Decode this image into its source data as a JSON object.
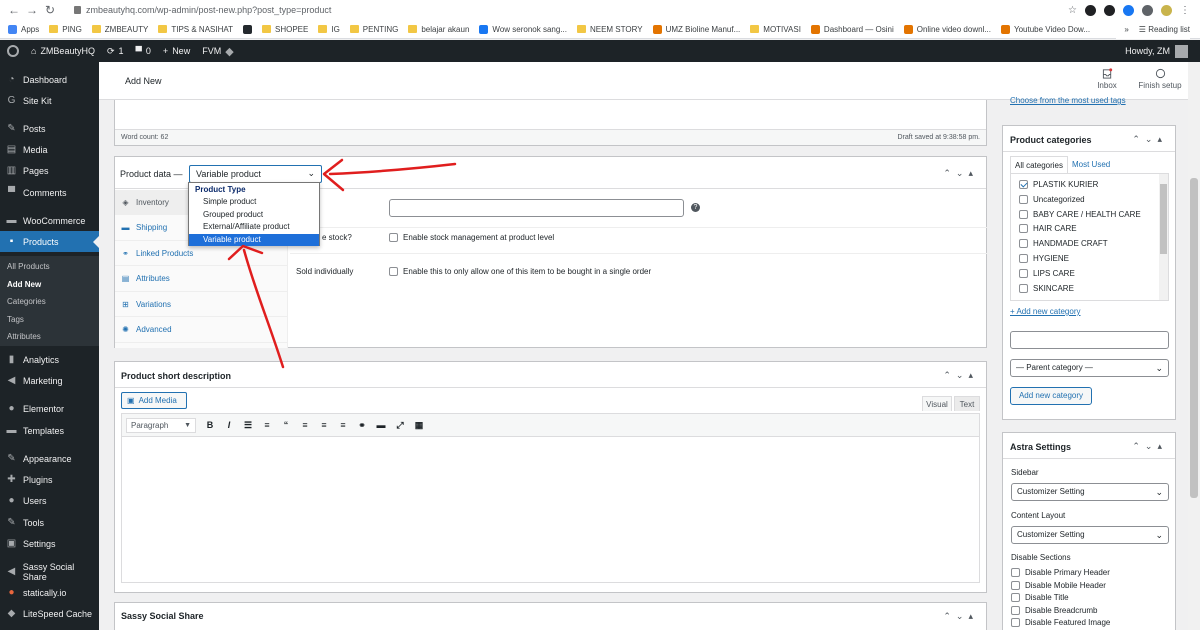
{
  "browser": {
    "url": "zmbeautyhq.com/wp-admin/post-new.php?post_type=product",
    "bookmarks": [
      {
        "label": "Apps",
        "icon": "apps-grid-icon"
      },
      {
        "label": "PING",
        "icon": "folder-icon"
      },
      {
        "label": "ZMBEAUTY",
        "icon": "folder-icon"
      },
      {
        "label": "TIPS & NASIHAT",
        "icon": "folder-icon"
      },
      {
        "label": "",
        "icon": "github-icon"
      },
      {
        "label": "SHOPEE",
        "icon": "folder-icon"
      },
      {
        "label": "IG",
        "icon": "folder-icon"
      },
      {
        "label": "PENTING",
        "icon": "folder-icon"
      },
      {
        "label": "belajar akaun",
        "icon": "folder-icon"
      },
      {
        "label": "Wow seronok sang...",
        "icon": "facebook-icon"
      },
      {
        "label": "NEEM STORY",
        "icon": "folder-icon"
      },
      {
        "label": "UMZ Bioline Manuf...",
        "icon": "site-icon"
      },
      {
        "label": "MOTIVASI",
        "icon": "folder-icon"
      },
      {
        "label": "Dashboard — Osini",
        "icon": "site-icon"
      },
      {
        "label": "Online video downl...",
        "icon": "site-icon"
      },
      {
        "label": "Youtube Video Dow...",
        "icon": "site-icon"
      }
    ],
    "reading_list": "Reading list",
    "more": "»"
  },
  "adminbar": {
    "site": "ZMBeautyHQ",
    "updates": "1",
    "comments": "0",
    "new": "New",
    "fvm": "FVM",
    "howdy": "Howdy, ZM"
  },
  "sidebar": {
    "items": [
      {
        "label": "Dashboard",
        "icon": "dashboard-icon"
      },
      {
        "label": "Site Kit",
        "icon": "google-icon"
      },
      {
        "label": "Posts",
        "icon": "pin-icon"
      },
      {
        "label": "Media",
        "icon": "media-icon"
      },
      {
        "label": "Pages",
        "icon": "pages-icon"
      },
      {
        "label": "Comments",
        "icon": "comments-icon"
      },
      {
        "label": "WooCommerce",
        "icon": "woo-icon"
      },
      {
        "label": "Products",
        "icon": "products-icon"
      },
      {
        "label": "Analytics",
        "icon": "analytics-icon"
      },
      {
        "label": "Marketing",
        "icon": "marketing-icon"
      },
      {
        "label": "Elementor",
        "icon": "elementor-icon"
      },
      {
        "label": "Templates",
        "icon": "templates-icon"
      },
      {
        "label": "Appearance",
        "icon": "appearance-icon"
      },
      {
        "label": "Plugins",
        "icon": "plugins-icon"
      },
      {
        "label": "Users",
        "icon": "users-icon"
      },
      {
        "label": "Tools",
        "icon": "tools-icon"
      },
      {
        "label": "Settings",
        "icon": "settings-icon"
      },
      {
        "label": "Sassy Social Share",
        "icon": "share-icon"
      },
      {
        "label": "statically.io",
        "icon": "statically-icon"
      },
      {
        "label": "LiteSpeed Cache",
        "icon": "litespeed-icon"
      }
    ],
    "submenu": [
      "All Products",
      "Add New",
      "Categories",
      "Tags",
      "Attributes"
    ]
  },
  "header": {
    "title": "Add New",
    "inbox": "Inbox",
    "finish": "Finish setup"
  },
  "editor": {
    "word_count": "Word count: 62",
    "draft_saved": "Draft saved at 9:38:58 pm."
  },
  "product_data": {
    "label": "Product data —",
    "selected_type": "Variable product",
    "dropdown": {
      "group": "Product Type",
      "options": [
        "Simple product",
        "Grouped product",
        "External/Affiliate product",
        "Variable product"
      ]
    },
    "tabs": [
      {
        "label": "Inventory",
        "icon": "inventory-icon"
      },
      {
        "label": "Shipping",
        "icon": "shipping-icon"
      },
      {
        "label": "Linked Products",
        "icon": "link-icon"
      },
      {
        "label": "Attributes",
        "icon": "attributes-icon"
      },
      {
        "label": "Variations",
        "icon": "variations-icon"
      },
      {
        "label": "Advanced",
        "icon": "advanced-icon"
      }
    ],
    "manage_stock_label": "e stock?",
    "manage_stock_text": "Enable stock management at product level",
    "sold_label": "Sold individually",
    "sold_text": "Enable this to only allow one of this item to be bought in a single order"
  },
  "short_desc": {
    "title": "Product short description",
    "add_media": "Add Media",
    "visual": "Visual",
    "text": "Text",
    "paragraph": "Paragraph"
  },
  "sassy": {
    "title": "Sassy Social Share"
  },
  "tags": {
    "link": "Choose from the most used tags"
  },
  "categories": {
    "title": "Product categories",
    "tab_all": "All categories",
    "tab_most": "Most Used",
    "items": [
      {
        "label": "PLASTIK KURIER",
        "checked": true
      },
      {
        "label": "Uncategorized",
        "checked": false
      },
      {
        "label": "BABY CARE / HEALTH CARE",
        "checked": false
      },
      {
        "label": "HAIR CARE",
        "checked": false
      },
      {
        "label": "HANDMADE CRAFT",
        "checked": false
      },
      {
        "label": "HYGIENE",
        "checked": false
      },
      {
        "label": "LIPS CARE",
        "checked": false
      },
      {
        "label": "SKINCARE",
        "checked": false
      }
    ],
    "add_link": "+ Add new category",
    "parent": "— Parent category —",
    "add_button": "Add new category"
  },
  "astra": {
    "title": "Astra Settings",
    "sidebar_label": "Sidebar",
    "sidebar_value": "Customizer Setting",
    "layout_label": "Content Layout",
    "layout_value": "Customizer Setting",
    "disable_label": "Disable Sections",
    "disable_items": [
      "Disable Primary Header",
      "Disable Mobile Header",
      "Disable Title",
      "Disable Breadcrumb",
      "Disable Featured Image"
    ]
  },
  "colors": {
    "admin_dark": "#1d2327",
    "accent": "#2271b1",
    "annotation": "#e01e1e"
  }
}
